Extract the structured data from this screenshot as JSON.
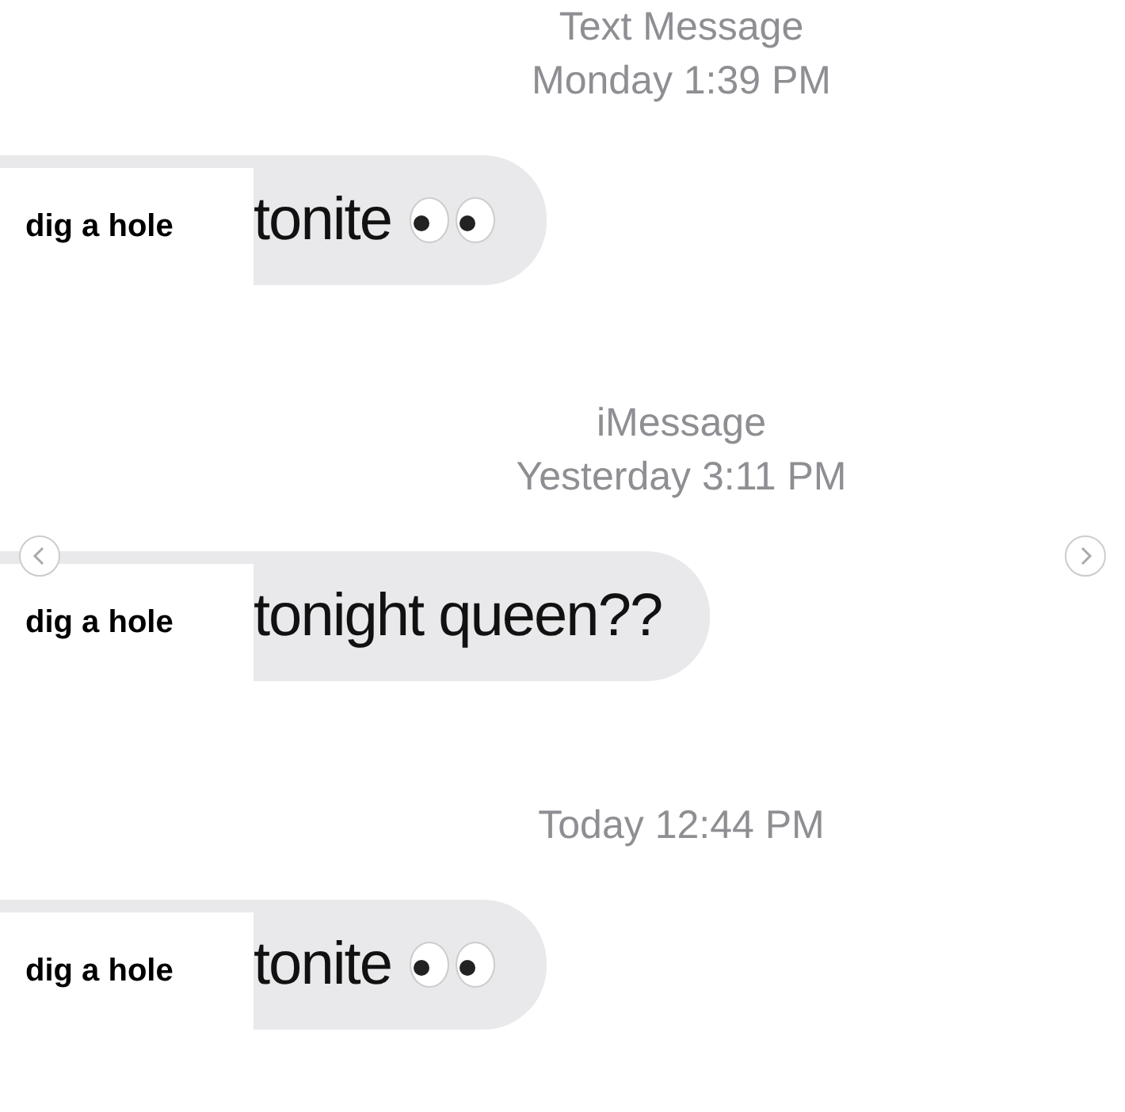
{
  "sections": [
    {
      "service": "Text Message",
      "timestamp": "Monday 1:39 PM",
      "bubble": {
        "label": "dig a hole",
        "text": "tonite",
        "eyes": true
      }
    },
    {
      "service": "iMessage",
      "timestamp": "Yesterday 3:11 PM",
      "bubble": {
        "label": "dig a hole",
        "text": "tonight queen??",
        "eyes": false
      }
    },
    {
      "timestamp": "Today 12:44 PM",
      "bubble": {
        "label": "dig a hole",
        "text": "tonite",
        "eyes": true
      }
    }
  ],
  "nav": {
    "previous": true,
    "next": true
  }
}
